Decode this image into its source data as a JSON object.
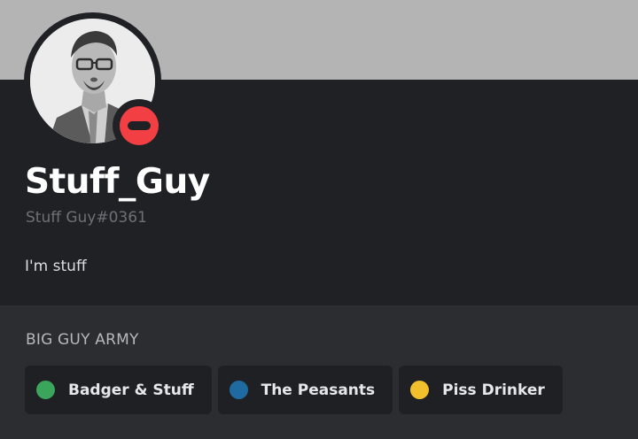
{
  "colors": {
    "banner": "#b4b4b4",
    "card_bg": "#202124",
    "status_dnd": "#f23f43"
  },
  "profile": {
    "display_name": "Stuff_Guy",
    "tag": "Stuff Guy#0361",
    "bio": "I'm stuff",
    "status": "do-not-disturb"
  },
  "roles_section": {
    "title": "BIG GUY ARMY",
    "roles": [
      {
        "label": "Badger & Stuff",
        "color": "#3ba55c"
      },
      {
        "label": "The Peasants",
        "color": "#1f6aa1"
      },
      {
        "label": "Piss Drinker",
        "color": "#f0c12c"
      }
    ]
  }
}
